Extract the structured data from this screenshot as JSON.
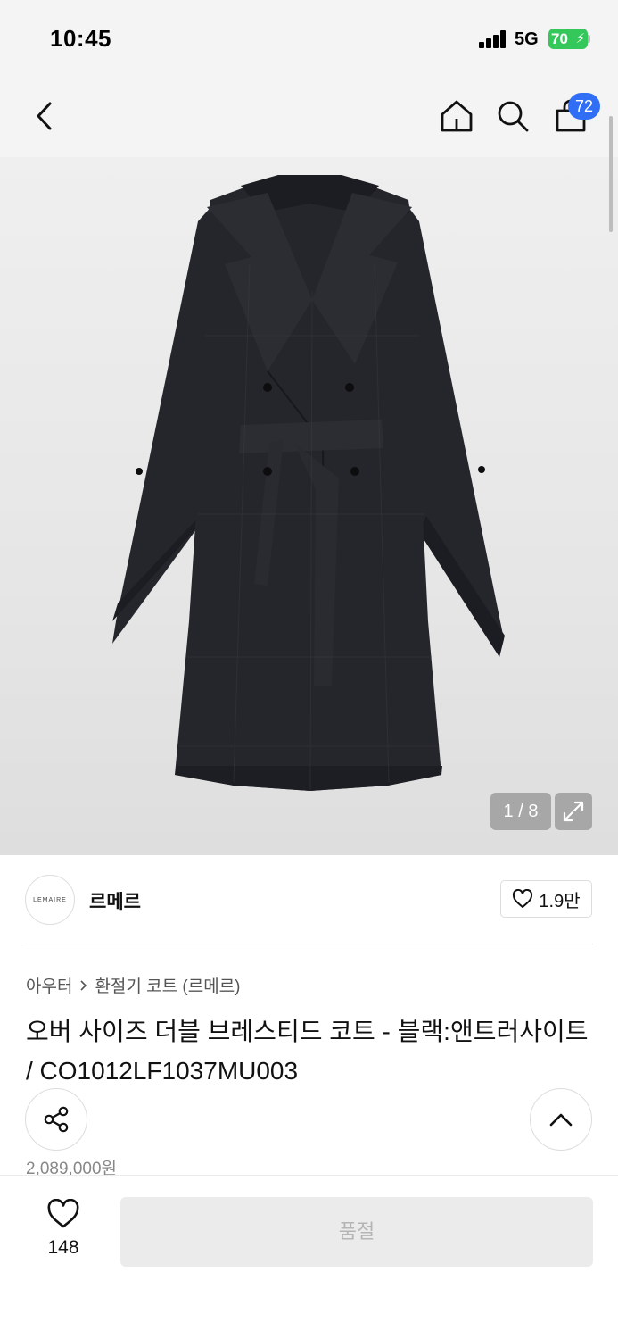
{
  "status_bar": {
    "time": "10:45",
    "network": "5G",
    "battery": "70"
  },
  "nav": {
    "cart_count": "72",
    "icons": [
      "back-chevron-icon",
      "home-icon",
      "search-icon",
      "shopping-bag-icon"
    ]
  },
  "gallery": {
    "counter": "1 / 8",
    "product_color": "#25262b"
  },
  "brand": {
    "logo_text": "LEMAIRE",
    "name": "르메르",
    "likes": "1.9만"
  },
  "breadcrumb": {
    "category": "아우터",
    "subcategory": "환절기 코트 (르메르)"
  },
  "product": {
    "title": "오버 사이즈 더블 브레스티드 코트 - 블랙:앤트러사이트 / CO1012LF1037MU003",
    "original_price": "2,089,000원"
  },
  "bottom_bar": {
    "wish_count": "148",
    "soldout_label": "품절"
  },
  "colors": {
    "accent": "#2f6ef5",
    "battery": "#34c759",
    "soldout_bg": "#ebebeb"
  }
}
